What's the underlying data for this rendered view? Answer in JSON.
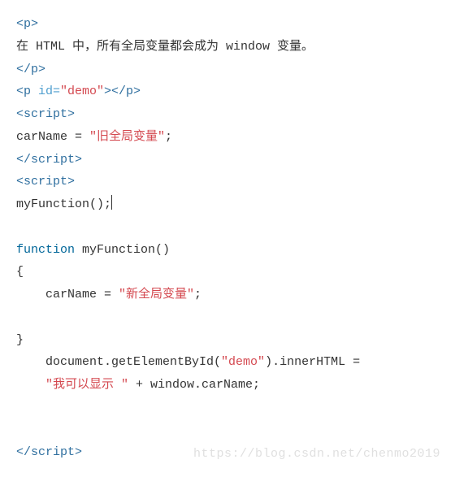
{
  "code": {
    "line1_open": "<p>",
    "line2_text": "在 HTML 中，所有全局变量都会成为 window 变量。",
    "line3_close": "</p>",
    "line4_p_open": "<p",
    "line4_attr": " id=",
    "line4_val": "\"demo\"",
    "line4_p_close": "></p>",
    "line5_script_open": "<script>",
    "line6_a": "carName = ",
    "line6_str": "\"旧全局变量\"",
    "line6_c": ";",
    "line7_script_close1": "</",
    "line7_script_close2": "script>",
    "line8_script_open": "<script>",
    "line9": "myFunction();",
    "line11_kw": "function",
    "line11_name": " myFunction()",
    "line12": "{",
    "line13_a": "    carName = ",
    "line13_str": "\"新全局变量\"",
    "line13_c": ";",
    "line15": "}",
    "line16_a": "    document.getElementById(",
    "line16_str": "\"demo\"",
    "line16_b": ").innerHTML =",
    "line17_a": "    ",
    "line17_str": "\"我可以显示 \"",
    "line17_b": " + window.carName;",
    "line20_script_close1": "</",
    "line20_script_close2": "script>"
  },
  "watermark": "https://blog.csdn.net/chenmo2019"
}
